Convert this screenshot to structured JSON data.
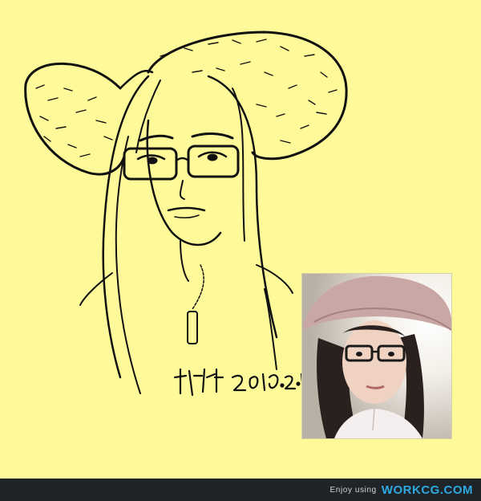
{
  "colors": {
    "background": "#fffa99",
    "ink": "#111111",
    "footer": "#1f2429",
    "footer_text": "#d4d4d4",
    "brand": "#2fa8e0"
  },
  "footer": {
    "text": "Enjoy using",
    "brand": "WORKCG.COM"
  }
}
